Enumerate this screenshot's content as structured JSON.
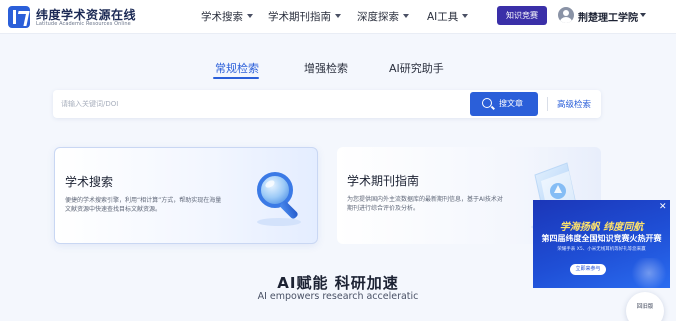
{
  "header": {
    "logo_title": "纬度学术资源在线",
    "logo_subtitle": "Latitude Academic Resources Online",
    "nav": [
      {
        "label": "学术搜索"
      },
      {
        "label": "学术期刊指南"
      },
      {
        "label": "深度探索"
      },
      {
        "label": "AI工具"
      }
    ],
    "contest_button": "知识竞赛",
    "user_name": "荆楚理工学院"
  },
  "search": {
    "tabs": [
      {
        "label": "常规检索",
        "active": true
      },
      {
        "label": "增强检索",
        "active": false
      },
      {
        "label": "AI研究助手",
        "active": false
      }
    ],
    "placeholder": "请输入关键词/DOI",
    "value": "",
    "button_label": "搜文章",
    "advanced_label": "高级检索"
  },
  "cards": [
    {
      "title": "学术搜索",
      "description": "便捷的学术搜索引擎，利用“相计算”方式，帮助实现在海量文献资源中快速查找目标文献资源。",
      "icon": "magnifier-icon"
    },
    {
      "title": "学术期刊指南",
      "description": "为您提供国内外主流数据库的最新期刊信息，基于AI技术对期刊进行综合评价及分析。",
      "icon": "journal-icon"
    }
  ],
  "ai_section": {
    "title": "AI赋能 科研加速",
    "subtitle": "AI empowers research acceleratic"
  },
  "ad": {
    "line1": "学海扬帆 纬度同航",
    "line2": "第四届纬度全国知识竞赛火热开赛",
    "line3": "荣耀手表 X5、小米无线耳机等好礼等您来赢",
    "button": "立即来参与",
    "close": "✕"
  },
  "float_button": "回旧版",
  "colors": {
    "accent": "#2b5fd9",
    "contest": "#3a2fa8",
    "ad_bg": "#1f4fd6",
    "ad_highlight": "#ffe36b"
  }
}
